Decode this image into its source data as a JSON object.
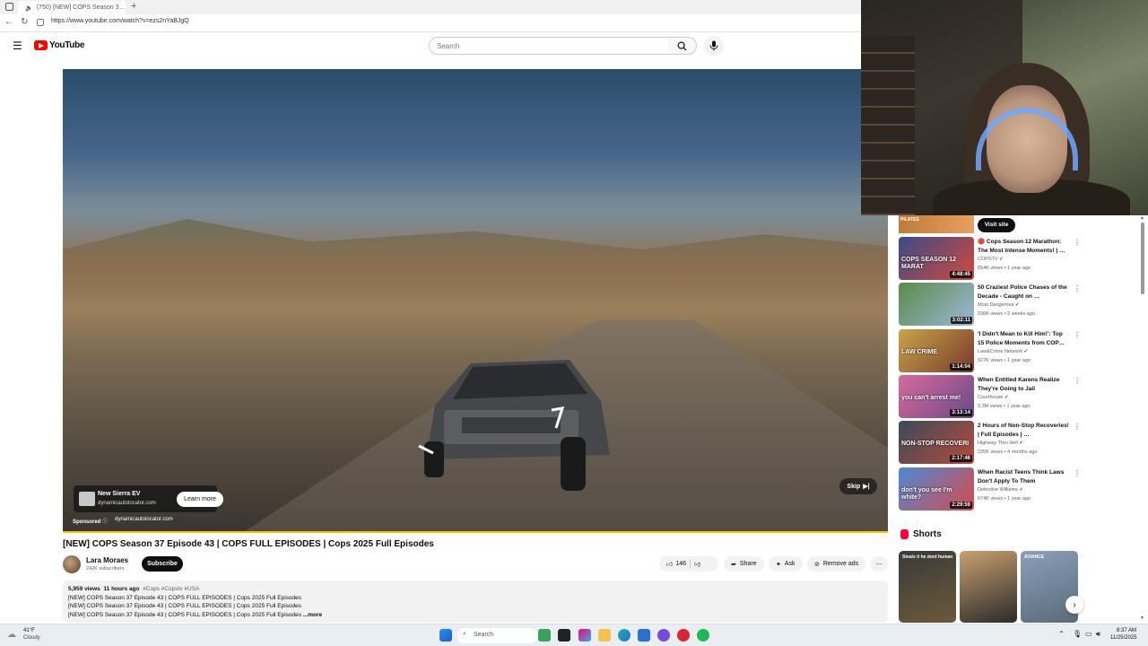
{
  "browser": {
    "tab_title": "(750) [NEW] COPS Season 3…",
    "url": "https://www.youtube.com/watch?v=ezs2nYaBJgQ"
  },
  "youtube": {
    "logo_text": "YouTube",
    "search_placeholder": "Search"
  },
  "ad": {
    "title": "New Sierra EV",
    "domain": "dynamicautolocator.com",
    "cta": "Learn more",
    "sponsored_label": "Sponsored",
    "sponsored_domain": "dynamicautolocator.com",
    "skip_label": "Skip"
  },
  "video": {
    "title": "[NEW] COPS Season 37 Episode 43 | COPS FULL EPISODES | Cops 2025 Full Episodes",
    "channel": "Lara Moraes",
    "subscribers": "242K subscribers",
    "subscribe_label": "Subscribe",
    "likes": "146",
    "share_label": "Share",
    "ask_label": "Ask",
    "remove_ads_label": "Remove ads",
    "views": "5,959 views",
    "posted": "11 hours ago",
    "tags": "#Cops #Copstv #USA",
    "description_lines": [
      "[NEW] COPS Season 37 Episode 43 | COPS FULL EPISODES | Cops 2025 Full Episodes",
      "[NEW] COPS Season 37 Episode 43 | COPS FULL EPISODES | Cops 2025 Full Episodes",
      "[NEW] COPS Season 37 Episode 43 | COPS FULL EPISODES | Cops 2025 Full Episodes"
    ],
    "more_label": "...more"
  },
  "sidebar": {
    "visit_site_label": "Visit site",
    "top_thumb_text": "PILATES",
    "recommendations": [
      {
        "title": "🔴 Cops Season 12 Marathon: The Most Intense Moments! | …",
        "channel": "COPSTV",
        "views": "654K views • 1 year ago",
        "duration": "4:48:45",
        "thumb_text": "COPS SEASON 12 MARAT",
        "color_a": "#3a4a8a",
        "color_b": "#d24a3a"
      },
      {
        "title": "50 Craziest Police Chases of the Decade - Caught on …",
        "channel": "Most Dangerous",
        "views": "236K views • 2 weeks ago",
        "duration": "3:02:11",
        "thumb_text": "",
        "color_a": "#5c8a4a",
        "color_b": "#9ab8d8"
      },
      {
        "title": "'I Didn't Mean to Kill Him!': Top 15 Police Moments from COP…",
        "channel": "Law&Crime Network",
        "views": "927K views • 1 year ago",
        "duration": "1:14:04",
        "thumb_text": "LAW CRIME",
        "color_a": "#c9a44a",
        "color_b": "#7a3a2a"
      },
      {
        "title": "When Entitled Karens Realize They're Going to Jail",
        "channel": "Courthouse",
        "views": "3.3M views • 1 year ago",
        "duration": "3:13:14",
        "thumb_text": "you can't arrest me!",
        "color_a": "#d86a9a",
        "color_b": "#6a4a8a"
      },
      {
        "title": "2 Hours of Non-Stop Recoveries! | Full Episodes | …",
        "channel": "Highway Thru Hell",
        "views": "235K views • 4 months ago",
        "duration": "2:17:46",
        "thumb_text": "NON-STOP RECOVERI",
        "color_a": "#3a4a5a",
        "color_b": "#b84a3a"
      },
      {
        "title": "When Racist Teens Think Laws Don't Apply To Them",
        "channel": "Detective Williams",
        "views": "674K views • 1 year ago",
        "duration": "2:29:59",
        "thumb_text": "don't you see I'm white?",
        "color_a": "#4a8ad8",
        "color_b": "#d84a4a"
      }
    ],
    "shorts_title": "Shorts",
    "shorts": [
      {
        "text": "Steals it he dont human",
        "color_a": "#3a3a3a",
        "color_b": "#6a5a3a"
      },
      {
        "text": "",
        "color_a": "#c9a070",
        "color_b": "#2a2a2a"
      },
      {
        "text": "AVIANCE",
        "color_a": "#8aa0b8",
        "color_b": "#5a6a7a"
      }
    ]
  },
  "taskbar": {
    "temperature": "41°F",
    "condition": "Cloudy",
    "search_label": "Search",
    "time": "8:37 AM",
    "date": "11/25/2025"
  }
}
